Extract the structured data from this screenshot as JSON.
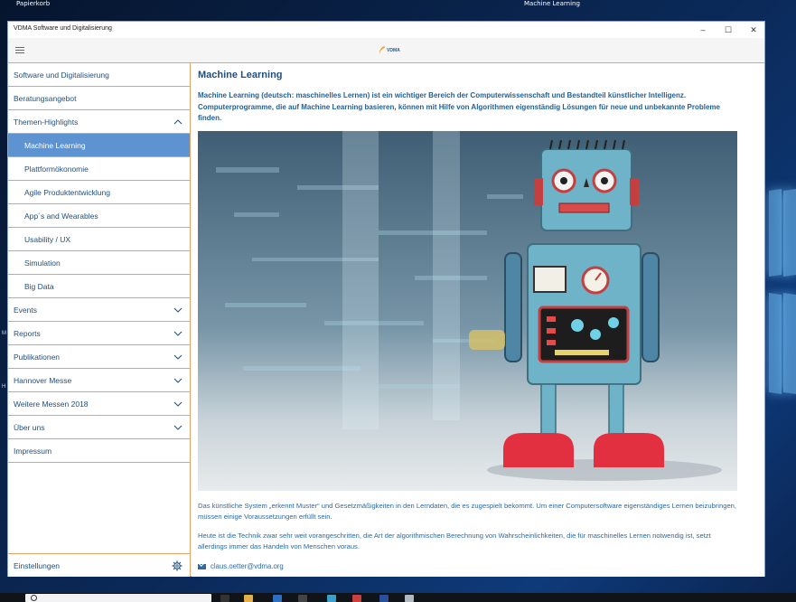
{
  "desktop": {
    "left_label": "Papierkorb",
    "center_label": "Machine Learning"
  },
  "window": {
    "title": "VDMA Software und Digitalisierung",
    "logo_text": "VDMA"
  },
  "sidebar": {
    "items": [
      {
        "label": "Software und Digitalisierung"
      },
      {
        "label": "Beratungsangebot"
      },
      {
        "label": "Themen-Highlights"
      },
      {
        "label": "Machine Learning"
      },
      {
        "label": "Plattformökonomie"
      },
      {
        "label": "Agile Produktentwicklung"
      },
      {
        "label": "App´s and Wearables"
      },
      {
        "label": "Usability / UX"
      },
      {
        "label": "Simulation"
      },
      {
        "label": "Big Data"
      },
      {
        "label": "Events"
      },
      {
        "label": "Reports"
      },
      {
        "label": "Publikationen"
      },
      {
        "label": "Hannover Messe"
      },
      {
        "label": "Weitere Messen 2018"
      },
      {
        "label": "Über uns"
      },
      {
        "label": "Impressum"
      }
    ],
    "settings_label": "Einstellungen"
  },
  "content": {
    "title": "Machine Learning",
    "intro": "Machine Learning (deutsch: maschinelles Lernen) ist ein wichtiger Bereich der Computerwissenschaft und Bestandteil künstlicher Intelligenz. Computerprogramme, die auf Machine Learning basieren, können mit Hilfe von Algorithmen eigenständig Lösungen für neue und unbekannte Probleme finden.",
    "paragraph1": "Das künstliche System „erkennt Muster“ und Gesetzmäßigkeiten in den Lerndaten, die es zugespielt bekommt. Um einer Computersoftware eigenständiges Lernen beizubringen, müssen einige Voraussetzungen erfüllt sein.",
    "paragraph2": "Heute ist die Technik zwar sehr weit vorangeschritten, die Art der algorithmischen Berechnung von Wahrscheinlichkeiten, die für maschinelles Lernen notwendig ist, setzt allerdings immer das Handeln von Menschen voraus.",
    "contact_email": "claus.oetter@vdma.org"
  },
  "colors": {
    "accent": "#e8a266",
    "nav_text": "#1f4f7d",
    "active_bg": "#5d93d0",
    "link": "#2a6aa6"
  }
}
